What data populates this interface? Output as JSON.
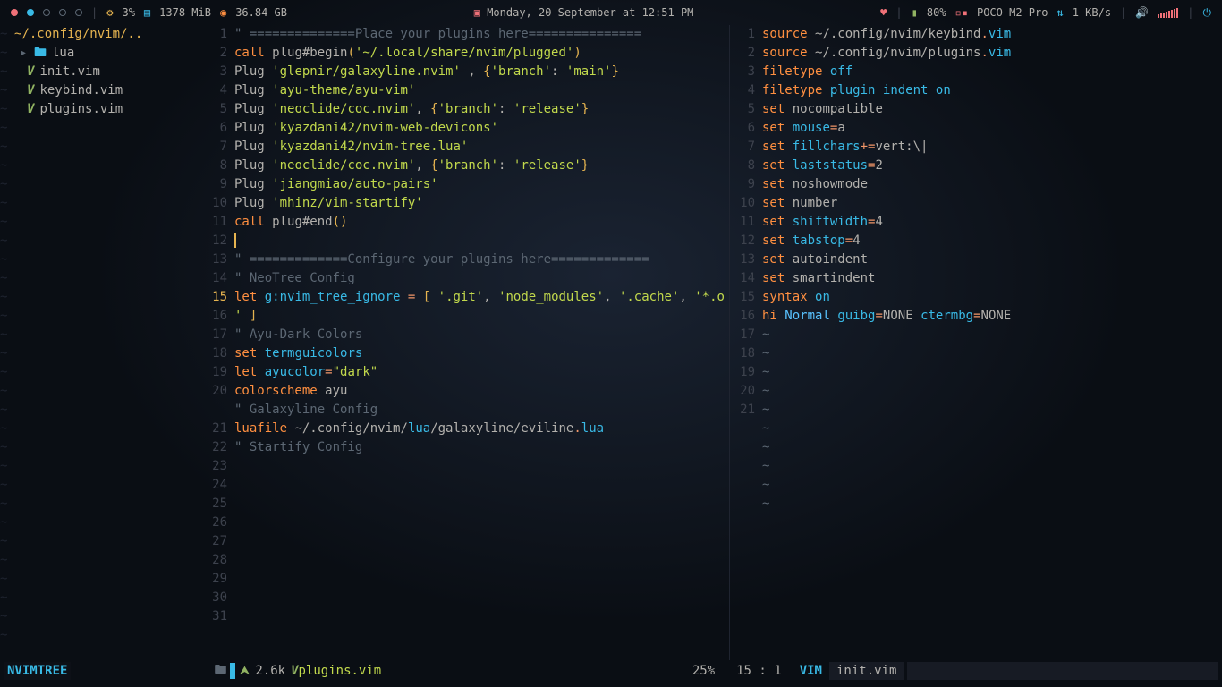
{
  "topbar": {
    "cpu": "3%",
    "mem": "1378 MiB",
    "disk": "36.84 GB",
    "date": "Monday, 20 September at 12:51 PM",
    "battery": "80%",
    "device": "POCO M2 Pro",
    "netspeed": "1 KB/s"
  },
  "tree": {
    "path": "~/.config/nvim/..",
    "folder": "lua",
    "files": [
      "init.vim",
      "keybind.vim",
      "plugins.vim"
    ]
  },
  "left_pane": {
    "lines": [
      {
        "n": 1,
        "t": "comment",
        "v": "\" ==============Place your plugins here==============="
      },
      {
        "n": 2,
        "t": "call_begin",
        "kw": "call",
        "fn": "plug#begin",
        "arg": "'~/.local/share/nvim/plugged'"
      },
      {
        "n": 3,
        "t": "blank"
      },
      {
        "n": 4,
        "t": "plug_branch",
        "pkg": "'glepnir/galaxyline.nvim'",
        "sep": " , ",
        "key": "'branch'",
        "val": "'main'"
      },
      {
        "n": 5,
        "t": "plug",
        "pkg": "'ayu-theme/ayu-vim'"
      },
      {
        "n": 6,
        "t": "plug_branch",
        "pkg": "'neoclide/coc.nvim'",
        "sep": ", ",
        "key": "'branch'",
        "val": "'release'"
      },
      {
        "n": 7,
        "t": "plug",
        "pkg": "'kyazdani42/nvim-web-devicons'"
      },
      {
        "n": 8,
        "t": "plug",
        "pkg": "'kyazdani42/nvim-tree.lua'"
      },
      {
        "n": 9,
        "t": "plug_branch",
        "pkg": "'neoclide/coc.nvim'",
        "sep": ", ",
        "key": "'branch'",
        "val": "'release'"
      },
      {
        "n": 10,
        "t": "plug",
        "pkg": "'jiangmiao/auto-pairs'"
      },
      {
        "n": 11,
        "t": "plug",
        "pkg": "'mhinz/vim-startify'"
      },
      {
        "n": 12,
        "t": "blank"
      },
      {
        "n": 13,
        "t": "call_end",
        "kw": "call",
        "fn": "plug#end"
      },
      {
        "n": 14,
        "t": "blank"
      },
      {
        "n": 15,
        "t": "cursor"
      },
      {
        "n": 16,
        "t": "blank"
      },
      {
        "n": 17,
        "t": "comment",
        "v": "\" =============Configure your plugins here============="
      },
      {
        "n": 18,
        "t": "blank"
      },
      {
        "n": 19,
        "t": "comment",
        "v": "\" NeoTree Config"
      },
      {
        "n": 20,
        "t": "let_array",
        "kw": "let",
        "var": "g:nvim_tree_ignore",
        "items": [
          "'.git'",
          "'node_modules'",
          "'.cache'",
          "'*.o'"
        ],
        "wrap": true
      },
      {
        "n": 21,
        "t": "blank"
      },
      {
        "n": 22,
        "t": "comment",
        "v": "\" Ayu-Dark Colors"
      },
      {
        "n": 23,
        "t": "set",
        "kw": "set",
        "opt": "termguicolors"
      },
      {
        "n": 24,
        "t": "let",
        "kw": "let",
        "var": "ayucolor",
        "val": "\"dark\""
      },
      {
        "n": 25,
        "t": "colorscheme",
        "kw": "colorscheme",
        "val": "ayu"
      },
      {
        "n": 26,
        "t": "blank"
      },
      {
        "n": 27,
        "t": "comment",
        "v": "\" Galaxyline Config"
      },
      {
        "n": 28,
        "t": "luafile",
        "kw": "luafile",
        "path": "~/.config/nvim/",
        "lua": "lua",
        "rest": "/galaxyline/eviline",
        "ext": ".lua"
      },
      {
        "n": 29,
        "t": "blank"
      },
      {
        "n": 30,
        "t": "comment",
        "v": "\" Startify Config"
      },
      {
        "n": 31,
        "t": "blank"
      }
    ]
  },
  "right_pane": {
    "lines": [
      {
        "n": 1,
        "t": "source",
        "kw": "source",
        "path": "~/.config/nvim/keybind",
        "ext": ".vim"
      },
      {
        "n": 2,
        "t": "source",
        "kw": "source",
        "path": "~/.config/nvim/plugins",
        "ext": ".vim"
      },
      {
        "n": 3,
        "t": "blank"
      },
      {
        "n": 4,
        "t": "filetype",
        "kw": "filetype",
        "val": "off"
      },
      {
        "n": 5,
        "t": "filetype3",
        "kw": "filetype",
        "a": "plugin",
        "b": "indent",
        "c": "on"
      },
      {
        "n": 6,
        "t": "blank"
      },
      {
        "n": 7,
        "t": "set",
        "kw": "set",
        "opt": "nocompatible"
      },
      {
        "n": 8,
        "t": "seteq",
        "kw": "set",
        "opt": "mouse",
        "eq": "=",
        "val": "a"
      },
      {
        "n": 9,
        "t": "seteq",
        "kw": "set",
        "opt": "fillchars",
        "eq": "+=",
        "val": "vert:\\|"
      },
      {
        "n": 10,
        "t": "seteq",
        "kw": "set",
        "opt": "laststatus",
        "eq": "=",
        "val": "2"
      },
      {
        "n": 11,
        "t": "set",
        "kw": "set",
        "opt": "noshowmode"
      },
      {
        "n": 12,
        "t": "set",
        "kw": "set",
        "opt": "number"
      },
      {
        "n": 13,
        "t": "seteq",
        "kw": "set",
        "opt": "shiftwidth",
        "eq": "=",
        "val": "4"
      },
      {
        "n": 14,
        "t": "seteq",
        "kw": "set",
        "opt": "tabstop",
        "eq": "=",
        "val": "4"
      },
      {
        "n": 15,
        "t": "set",
        "kw": "set",
        "opt": "autoindent"
      },
      {
        "n": 16,
        "t": "set",
        "kw": "set",
        "opt": "smartindent"
      },
      {
        "n": 17,
        "t": "blank"
      },
      {
        "n": 18,
        "t": "syntax",
        "kw": "syntax",
        "val": "on"
      },
      {
        "n": 19,
        "t": "hi",
        "kw": "hi",
        "grp": "Normal",
        "a": "guibg",
        "av": "NONE",
        "b": "ctermbg",
        "bv": "NONE"
      },
      {
        "n": 20,
        "t": "blank"
      },
      {
        "n": 21,
        "t": "blank"
      }
    ],
    "tildes": 10
  },
  "status": {
    "nvimtree": "NVIMTREE",
    "size": "2.6k",
    "file": "plugins.vim",
    "pct": "25%",
    "pos": "15 : 1",
    "vim": "VIM",
    "file2": "init.vim"
  },
  "cursor_line": 15
}
